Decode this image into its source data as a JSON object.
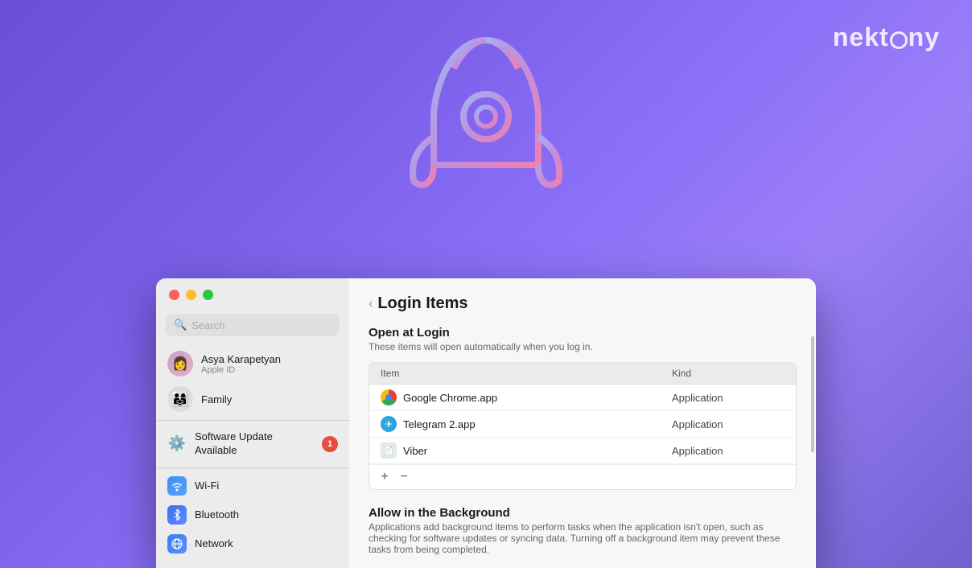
{
  "brand": {
    "name": "nektony",
    "logo_text": "nekt"
  },
  "background": {
    "gradient_start": "#6b4fd8",
    "gradient_end": "#7060d0"
  },
  "window": {
    "traffic_lights": {
      "close": "close",
      "minimize": "minimize",
      "maximize": "maximize"
    }
  },
  "sidebar": {
    "search_placeholder": "Search",
    "user": {
      "name": "Asya Karapetyan",
      "subtitle": "Apple ID"
    },
    "items": [
      {
        "label": "Family",
        "icon": "family-icon"
      },
      {
        "label": "Software Update Available",
        "badge": "1"
      },
      {
        "label": "Wi-Fi",
        "icon": "wifi-icon"
      },
      {
        "label": "Bluetooth",
        "icon": "bluetooth-icon"
      },
      {
        "label": "Network",
        "icon": "network-icon"
      }
    ]
  },
  "main": {
    "back_label": "Back",
    "page_title": "Login Items",
    "open_at_login": {
      "title": "Open at Login",
      "subtitle": "These items will open automatically when you log in."
    },
    "table": {
      "headers": [
        "Item",
        "Kind"
      ],
      "rows": [
        {
          "name": "Google Chrome.app",
          "kind": "Application",
          "icon": "chrome"
        },
        {
          "name": "Telegram 2.app",
          "kind": "Application",
          "icon": "telegram"
        },
        {
          "name": "Viber",
          "kind": "Application",
          "icon": "viber"
        }
      ],
      "add_button": "+",
      "remove_button": "−"
    },
    "allow_background": {
      "title": "Allow in the Background",
      "subtitle": "Applications add background items to perform tasks when the application isn't open, such as checking for software updates or syncing data. Turning off a background item may prevent these tasks from being completed."
    }
  }
}
